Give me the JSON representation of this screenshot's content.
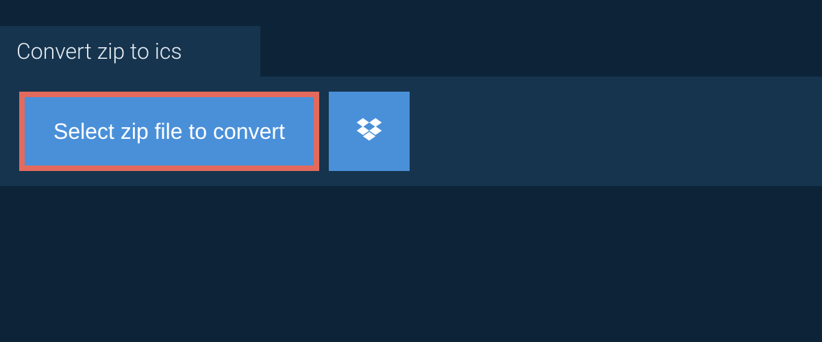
{
  "tab": {
    "title": "Convert zip to ics"
  },
  "upload": {
    "select_button_label": "Select zip file to convert"
  },
  "colors": {
    "background_dark": "#0d2438",
    "panel": "#16344e",
    "button_blue": "#4a90d9",
    "highlight_border": "#e36a5c",
    "text_light": "#e8eef4"
  }
}
